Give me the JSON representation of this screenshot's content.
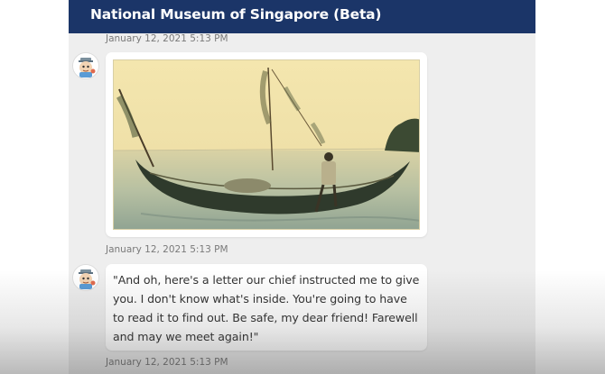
{
  "header": {
    "title": "National Museum of Singapore (Beta)",
    "background_color": "#1b3568"
  },
  "messages": [
    {
      "type": "timestamp",
      "time": "January 12, 2021 5:13 PM"
    },
    {
      "type": "image",
      "avatar_icon": "museum-mascot-icon",
      "image_description_icon": "vintage-canoe-photo",
      "time": "January 12, 2021 5:13 PM"
    },
    {
      "type": "text",
      "avatar_icon": "museum-mascot-icon",
      "text": "\"And oh, here's a letter our chief instructed me to give you. I don't know what's inside. You're going to have to read it to find out. Be safe, my dear friend! Farewell and may we meet again!\"",
      "time": "January 12, 2021 5:13 PM"
    }
  ]
}
